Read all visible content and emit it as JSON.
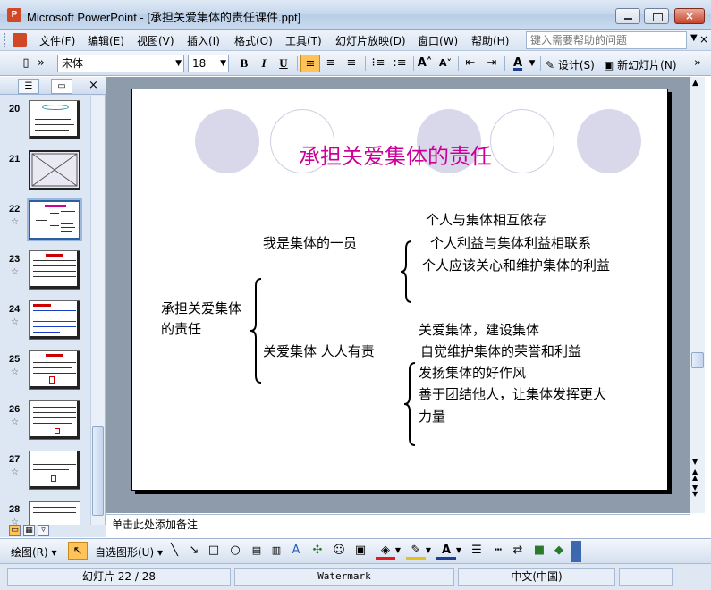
{
  "window": {
    "title": "Microsoft PowerPoint - [承担关爱集体的责任课件.ppt]",
    "close_glyph": "×"
  },
  "menu": {
    "items": [
      "文件(F)",
      "编辑(E)",
      "视图(V)",
      "插入(I)",
      "格式(O)",
      "工具(T)",
      "幻灯片放映(D)",
      "窗口(W)",
      "帮助(H)"
    ],
    "help_placeholder": "键入需要帮助的问题",
    "close_doc": "×"
  },
  "format_toolbar": {
    "font_name": "宋体",
    "font_size": "18",
    "bold": "B",
    "italic": "I",
    "underline": "U",
    "design_label": "设计(S)",
    "new_slide_label": "新幻灯片(N)"
  },
  "slides_pane": {
    "close_glyph": "×",
    "thumbnails": [
      {
        "number": "20",
        "star": ""
      },
      {
        "number": "21",
        "star": ""
      },
      {
        "number": "22",
        "star": "☆"
      },
      {
        "number": "23",
        "star": "☆"
      },
      {
        "number": "24",
        "star": "☆"
      },
      {
        "number": "25",
        "star": "☆"
      },
      {
        "number": "26",
        "star": "☆"
      },
      {
        "number": "27",
        "star": "☆"
      },
      {
        "number": "28",
        "star": "☆"
      }
    ],
    "selected": "22"
  },
  "slide": {
    "title": "承担关爱集体的责任",
    "root_line1": "承担关爱集体",
    "root_line2": "的责任",
    "branch1": "我是集体的一员",
    "branch1_items": [
      "个人与集体相互依存",
      "个人利益与集体利益相联系",
      "个人应该关心和维护集体的利益"
    ],
    "branch2": "关爱集体 人人有责",
    "branch2_items": [
      "关爱集体，建设集体",
      "自觉维护集体的荣誉和利益",
      "发扬集体的好作风",
      "善于团结他人，让集体发挥更大",
      "力量"
    ],
    "title_color": "#cc0099"
  },
  "notes": {
    "placeholder": "单击此处添加备注"
  },
  "draw_toolbar": {
    "draw_label": "绘图(R)",
    "autoshape_label": "自选图形(U)"
  },
  "status": {
    "slide_position": "幻灯片 22 / 28",
    "template": "Watermark",
    "language": "中文(中国)"
  }
}
